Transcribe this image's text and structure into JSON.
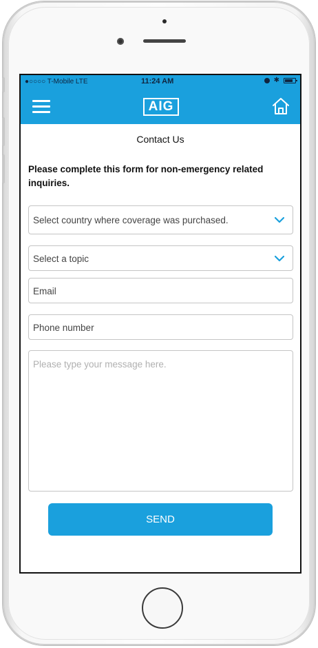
{
  "status_bar": {
    "carrier": "●○○○○ T-Mobile  LTE",
    "time": "11:24 AM",
    "bluetooth_glyph": "✱"
  },
  "nav": {
    "logo_text": "AIG",
    "menu_icon": "hamburger-menu-icon",
    "home_icon": "home-icon",
    "color": "#1aa0dd"
  },
  "page": {
    "title": "Contact Us",
    "intro": "Please complete this form for non-emergency related inquiries."
  },
  "form": {
    "country_placeholder": "Select country where coverage was purchased.",
    "topic_placeholder": "Select a topic",
    "email_placeholder": "Email",
    "phone_placeholder": "Phone number",
    "message_placeholder": "Please type your message here.",
    "send_label": "SEND"
  }
}
